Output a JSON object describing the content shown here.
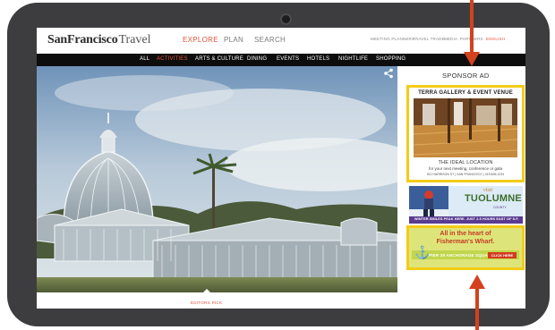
{
  "site": {
    "logo_bold": "SanFrancisco",
    "logo_light": "Travel"
  },
  "top_nav": {
    "explore": "EXPLORE",
    "plan": "PLAN",
    "search": "SEARCH"
  },
  "utility_nav": {
    "meeting_planners": "MEETING PLANNERS",
    "travel_trade": "TRAVEL TRADE",
    "media": "MEDIA",
    "partners": "PARTNERS",
    "english": "ENGLISH"
  },
  "categories": [
    "ALL",
    "ACTIVITIES",
    "ARTS & CULTURE",
    "DINING",
    "EVENTS",
    "HOTELS",
    "NIGHTLIFE",
    "SHOPPING"
  ],
  "active_category": "ACTIVITIES",
  "hero": {
    "caption": "EDITORS PICK"
  },
  "sponsor": {
    "label": "SPONSOR AD",
    "ad1": {
      "title": "TERRA GALLERY & EVENT VENUE",
      "headline": "THE IDEAL LOCATION",
      "subline": "for your next meeting, conference or gala",
      "address": "511 HARRISON ST  |  SAN FRANCISCO  |  415.896.1234"
    },
    "ad2": {
      "visit": "visit",
      "name": "TUOLUMNE",
      "county": "COUNTY",
      "tagline": "WINTER SMILES PEAK HERE. JUST 2.5 HOURS EAST OF S.F."
    },
    "ad3": {
      "line1": "All in the heart of",
      "line2": "Fisherman's Wharf.",
      "brand": "PIER 39 ANCHORAGE SQUARE",
      "cta": "CLICK HERE"
    }
  },
  "colors": {
    "accent": "#e2533d",
    "highlight": "#f4cc16",
    "navbar": "#0d0d0d",
    "device": "#3d3d3f"
  }
}
